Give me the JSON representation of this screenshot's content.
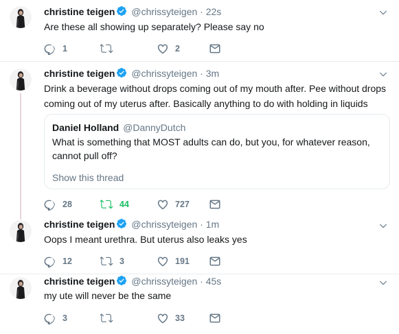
{
  "author": {
    "name": "christine teigen",
    "handle": "@chrissyteigen",
    "verified": true,
    "separator": "·"
  },
  "tweets": [
    {
      "time": "22s",
      "text": "Are these all showing up separately? Please say no",
      "replies": "1",
      "retweets": "",
      "likes": "2",
      "retweeted": false
    },
    {
      "time": "3m",
      "text": "Drink a beverage without drops coming out of my mouth after. Pee without drops coming out of my uterus after. Basically anything to do with holding in liquids",
      "quote": {
        "name": "Daniel Holland",
        "handle": "@DannyDutch",
        "text": "What is something that MOST adults can do, but you, for whatever reason, cannot pull off?",
        "link": "Show this thread"
      },
      "replies": "28",
      "retweets": "44",
      "likes": "727",
      "retweeted": true
    },
    {
      "time": "1m",
      "text": "Oops I meant urethra. But uterus also leaks yes",
      "replies": "12",
      "retweets": "3",
      "likes": "191",
      "retweeted": false
    },
    {
      "time": "45s",
      "text": "my ute will never be the same",
      "replies": "3",
      "retweets": "",
      "likes": "33",
      "retweeted": false
    }
  ],
  "icons": {
    "reply": "reply-icon",
    "retweet": "retweet-icon",
    "like": "heart-icon",
    "dm": "envelope-icon",
    "more": "chevron-down-icon",
    "verified": "verified-badge-icon"
  },
  "colors": {
    "text": "#14171a",
    "secondary": "#657786",
    "verified": "#1da1f2",
    "retweet_active": "#17bf63",
    "divider": "#e6ecf0",
    "thread_line": "#e8d3dd"
  }
}
